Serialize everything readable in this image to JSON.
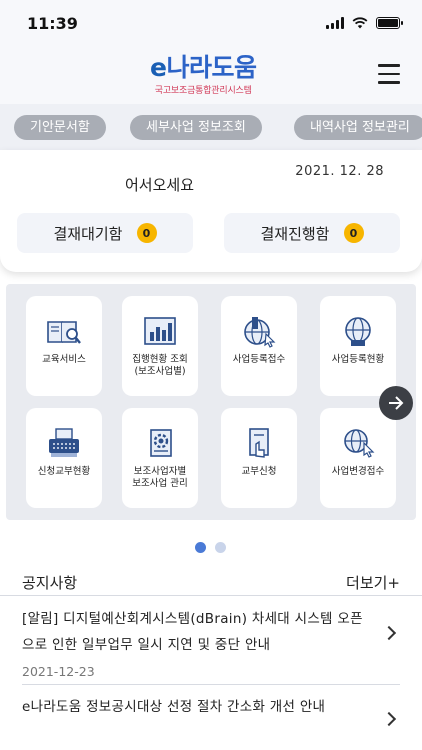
{
  "status_bar": {
    "time": "11:39"
  },
  "header": {
    "logo_e": "e",
    "logo_main": "나라도움",
    "logo_sub": "국고보조금통합관리시스템"
  },
  "tabs": [
    "기안문서함",
    "세부사업 정보조회",
    "내역사업 정보관리"
  ],
  "welcome": {
    "greeting": "어서오세요",
    "date": "2021. 12. 28",
    "pending_label": "결재대기함",
    "pending_count": "0",
    "progress_label": "결재진행함",
    "progress_count": "0"
  },
  "menu": [
    {
      "label": "교육서비스",
      "icon": "book-search-icon"
    },
    {
      "label": "집행현황 조회\n(보조사업별)",
      "icon": "bar-chart-icon"
    },
    {
      "label": "사업등록접수",
      "icon": "globe-building-icon"
    },
    {
      "label": "사업등록현황",
      "icon": "globe-list-icon"
    },
    {
      "label": "신청교부현황",
      "icon": "typewriter-icon"
    },
    {
      "label": "보조사업자별\n보조사업 관리",
      "icon": "gear-document-icon"
    },
    {
      "label": "교부신청",
      "icon": "hand-document-icon"
    },
    {
      "label": "사업변경접수",
      "icon": "globe-cursor-icon"
    }
  ],
  "pager": {
    "pages": 2,
    "active": 1
  },
  "notices": {
    "title": "공지사항",
    "more_label": "더보기+",
    "items": [
      {
        "text": "[알림] 디지털예산회계시스템(dBrain) 차세대 시스템 오픈으로 인한 일부업무 일시 지연 및 중단 안내",
        "date": "2021-12-23"
      },
      {
        "text": "e나라도움 정보공시대상 선정 절차 간소화 개선 안내",
        "date": ""
      }
    ]
  },
  "colors": {
    "accent": "#4a7ad6",
    "badge": "#f7b500",
    "brand_red": "#d23c5a"
  }
}
